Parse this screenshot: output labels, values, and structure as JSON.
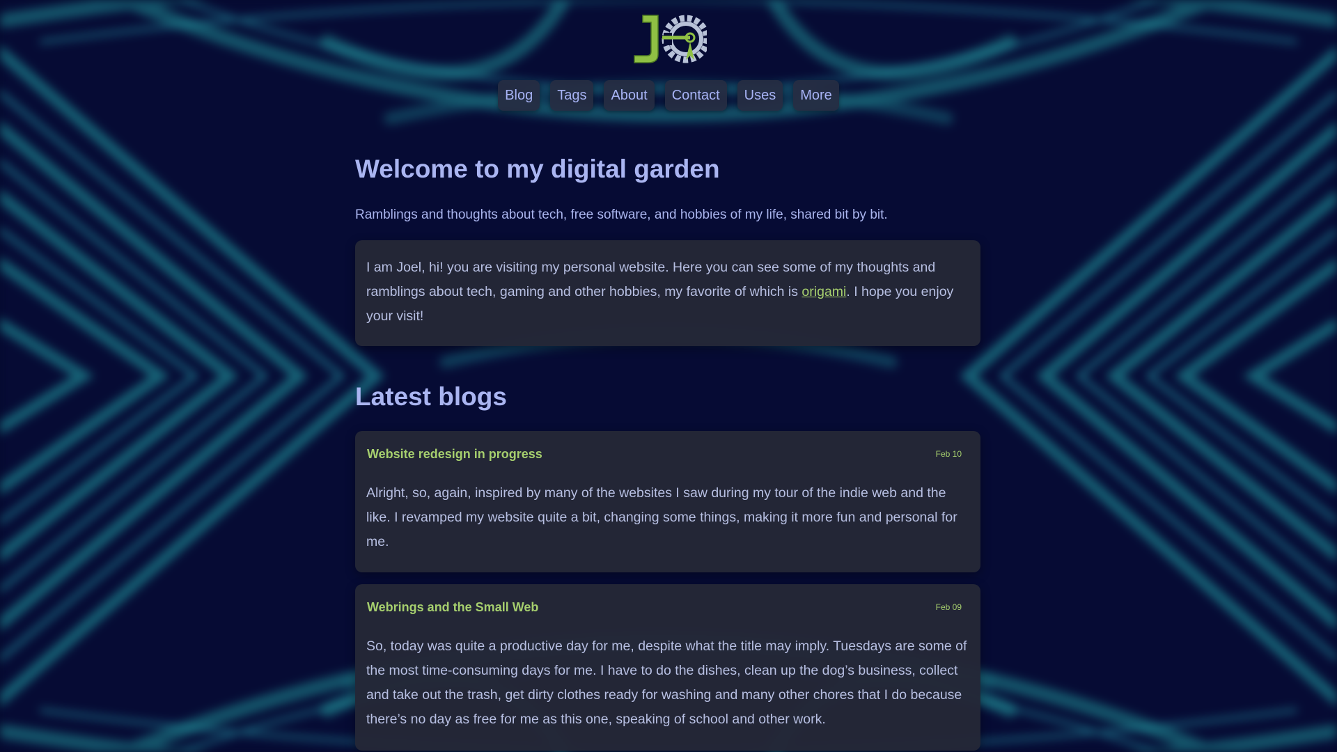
{
  "site": {
    "logo_icon": "jg-gear-logo",
    "colors": {
      "accent_green": "#a6cf6e",
      "text_lavender": "#aab5f1",
      "card_bg": "#242737",
      "nav_bg": "#262c42"
    }
  },
  "nav": {
    "items": [
      {
        "label": "Blog"
      },
      {
        "label": "Tags"
      },
      {
        "label": "About"
      },
      {
        "label": "Contact"
      },
      {
        "label": "Uses"
      },
      {
        "label": "More"
      }
    ]
  },
  "hero": {
    "title": "Welcome to my digital garden",
    "subtitle": "Ramblings and thoughts about tech, free software, and hobbies of my life, shared bit by bit."
  },
  "intro": {
    "text_before_link": "I am Joel, hi! you are visiting my personal website. Here you can see some of my thoughts and ramblings about tech, gaming and other hobbies, my favorite of which is ",
    "link_text": "origami",
    "text_after_link": ". I hope you enjoy your visit!"
  },
  "latest": {
    "heading": "Latest blogs",
    "posts": [
      {
        "title": "Website redesign in progress",
        "date": "Feb 10",
        "excerpt": "Alright, so, again, inspired by many of the websites I saw during my tour of the indie web and the like. I revamped my website quite a bit, changing some things, making it more fun and personal for me."
      },
      {
        "title": "Webrings and the Small Web",
        "date": "Feb 09",
        "excerpt": "So, today was quite a productive day for me, despite what the title may imply. Tuesdays are some of the most time-consuming days for me. I have to do the dishes, clean up the dog’s business, collect and take out the trash, get dirty clothes ready for washing and many other chores that I do because there’s no day as free for me as this one, speaking of school and other work."
      }
    ]
  }
}
